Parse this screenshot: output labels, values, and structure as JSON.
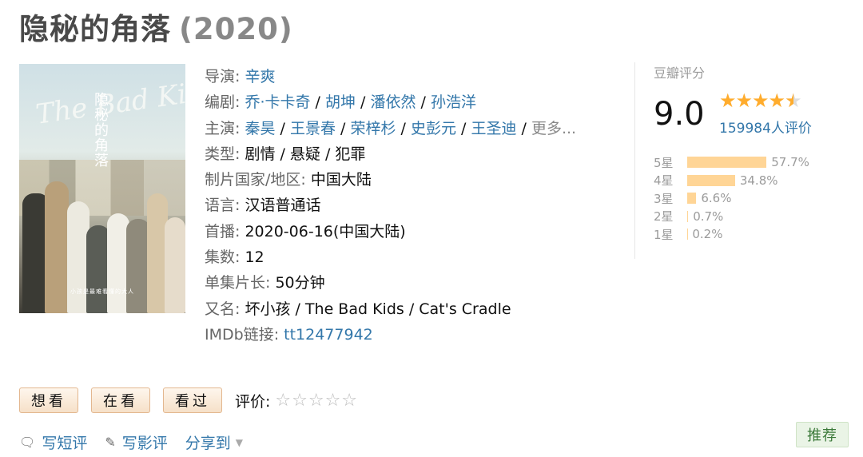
{
  "title": {
    "name": "隐秘的角落",
    "year": "(2020)"
  },
  "poster": {
    "logo_text": "The Bad Kids",
    "cn_title": "隐秘的角落",
    "caption": "小孩是最难看懂的大人"
  },
  "info": {
    "director_label": "导演:",
    "director": "辛爽",
    "writers_label": "编剧:",
    "writers": [
      "乔·卡卡奇",
      "胡坤",
      "潘依然",
      "孙浩洋"
    ],
    "cast_label": "主演:",
    "cast": [
      "秦昊",
      "王景春",
      "荣梓杉",
      "史彭元",
      "王圣迪"
    ],
    "cast_more": "更多...",
    "genre_label": "类型:",
    "genre": "剧情 / 悬疑 / 犯罪",
    "region_label": "制片国家/地区:",
    "region": "中国大陆",
    "language_label": "语言:",
    "language": "汉语普通话",
    "premiere_label": "首播:",
    "premiere": "2020-06-16(中国大陆)",
    "episodes_label": "集数:",
    "episodes": "12",
    "runtime_label": "单集片长:",
    "runtime": "50分钟",
    "aka_label": "又名:",
    "aka": "坏小孩 / The Bad Kids / Cat's Cradle",
    "imdb_label": "IMDb链接:",
    "imdb": "tt12477942"
  },
  "rating": {
    "label": "豆瓣评分",
    "score": "9.0",
    "stars_value": 4.5,
    "count": "159984人评价",
    "breakdown": [
      {
        "label": "5星",
        "percent_text": "57.7%",
        "percent": 57.7
      },
      {
        "label": "4星",
        "percent_text": "34.8%",
        "percent": 34.8
      },
      {
        "label": "3星",
        "percent_text": "6.6%",
        "percent": 6.6
      },
      {
        "label": "2星",
        "percent_text": "0.7%",
        "percent": 0.7
      },
      {
        "label": "1星",
        "percent_text": "0.2%",
        "percent": 0.2
      }
    ]
  },
  "actions": {
    "want": "想看",
    "watching": "在看",
    "watched": "看过",
    "rate_label": "评价:",
    "rate_stars": "☆☆☆☆☆"
  },
  "links": {
    "short_review": "写短评",
    "review": "写影评",
    "share": "分享到"
  },
  "recommend": "推荐",
  "colors": {
    "link": "#3377aa",
    "star": "#ffac2d",
    "bar": "#ffd596"
  }
}
